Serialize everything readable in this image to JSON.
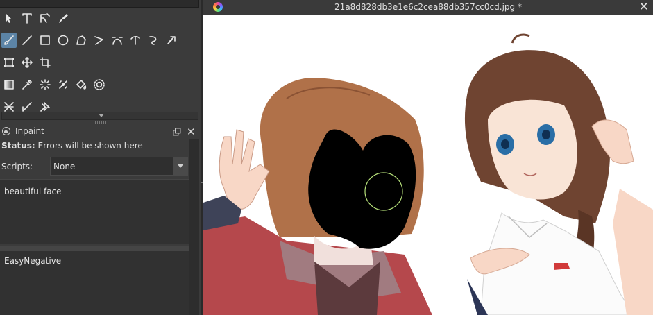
{
  "toolbox": {
    "rows": [
      [
        "select-shapes-tool",
        "text-tool",
        "edit-shapes-tool",
        "calligraphy-tool"
      ],
      [
        "freehand-brush-tool",
        "line-tool",
        "rectangle-tool",
        "ellipse-tool",
        "polygon-tool",
        "polyline-tool",
        "bezier-curve-tool",
        "freehand-path-tool",
        "dynamic-brush-tool",
        "multibrush-tool"
      ],
      [
        "transform-tool",
        "move-tool",
        "crop-tool"
      ],
      [
        "gradient-tool",
        "color-sampler-tool",
        "colorize-mask-tool",
        "smart-patch-tool",
        "fill-tool",
        "enclose-fill-tool"
      ],
      [
        "assistant-tool",
        "measure-tool",
        "reference-images-tool"
      ]
    ],
    "active": "freehand-brush-tool"
  },
  "panel": {
    "title": "Inpaint",
    "status_label": "Status:",
    "status_text": "Errors will be shown here",
    "scripts_label": "Scripts:",
    "scripts_value": "None",
    "prompt": "beautiful face",
    "negative_prompt": "EasyNegative"
  },
  "document": {
    "title": "21a8d828db3e1e6c2cea88db357cc0cd.jpg *"
  },
  "colors": {
    "accent": "#5c84a6",
    "dock_bg": "#3b3b3b",
    "canvas_bg": "#ffffff",
    "brush_cursor": "#b6e07a"
  }
}
